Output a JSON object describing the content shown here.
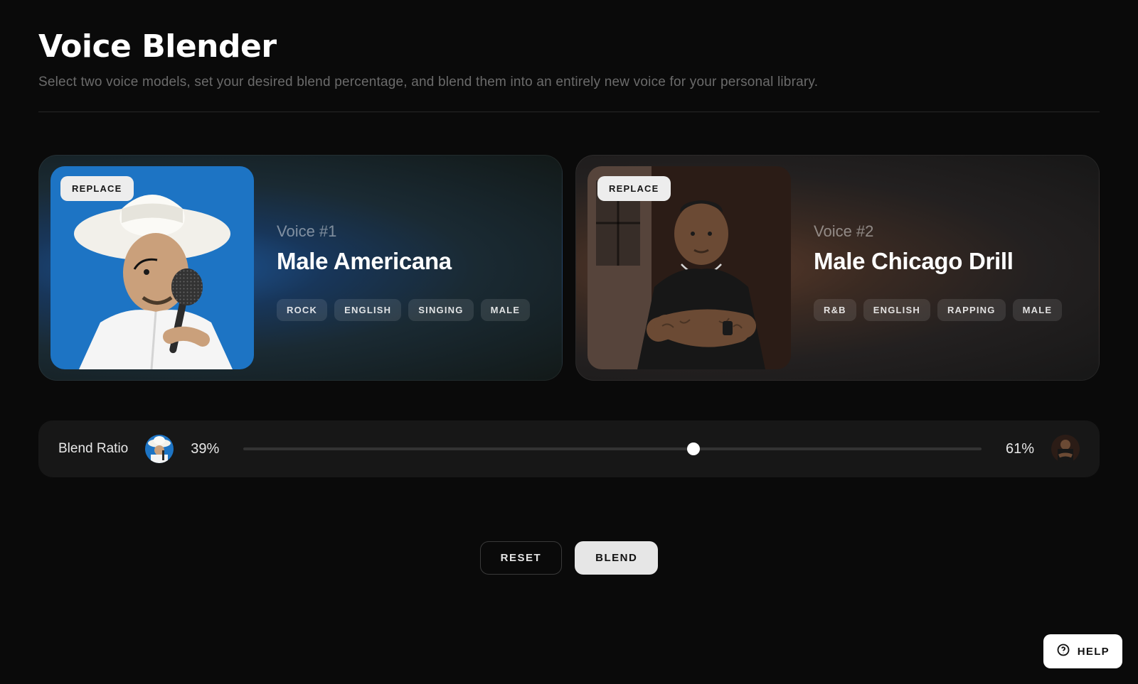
{
  "header": {
    "title": "Voice Blender",
    "subtitle": "Select two voice models, set your desired blend percentage, and blend them into an entirely new voice for your personal library."
  },
  "voices": [
    {
      "label": "Voice #1",
      "name": "Male Americana",
      "replace_label": "REPLACE",
      "tags": [
        "ROCK",
        "ENGLISH",
        "SINGING",
        "MALE"
      ]
    },
    {
      "label": "Voice #2",
      "name": "Male Chicago Drill",
      "replace_label": "REPLACE",
      "tags": [
        "R&B",
        "ENGLISH",
        "RAPPING",
        "MALE"
      ]
    }
  ],
  "blend": {
    "label": "Blend Ratio",
    "left_pct": "39%",
    "right_pct": "61%",
    "thumb_position_pct": 61
  },
  "actions": {
    "reset": "RESET",
    "blend": "BLEND"
  },
  "help": {
    "label": "HELP"
  }
}
